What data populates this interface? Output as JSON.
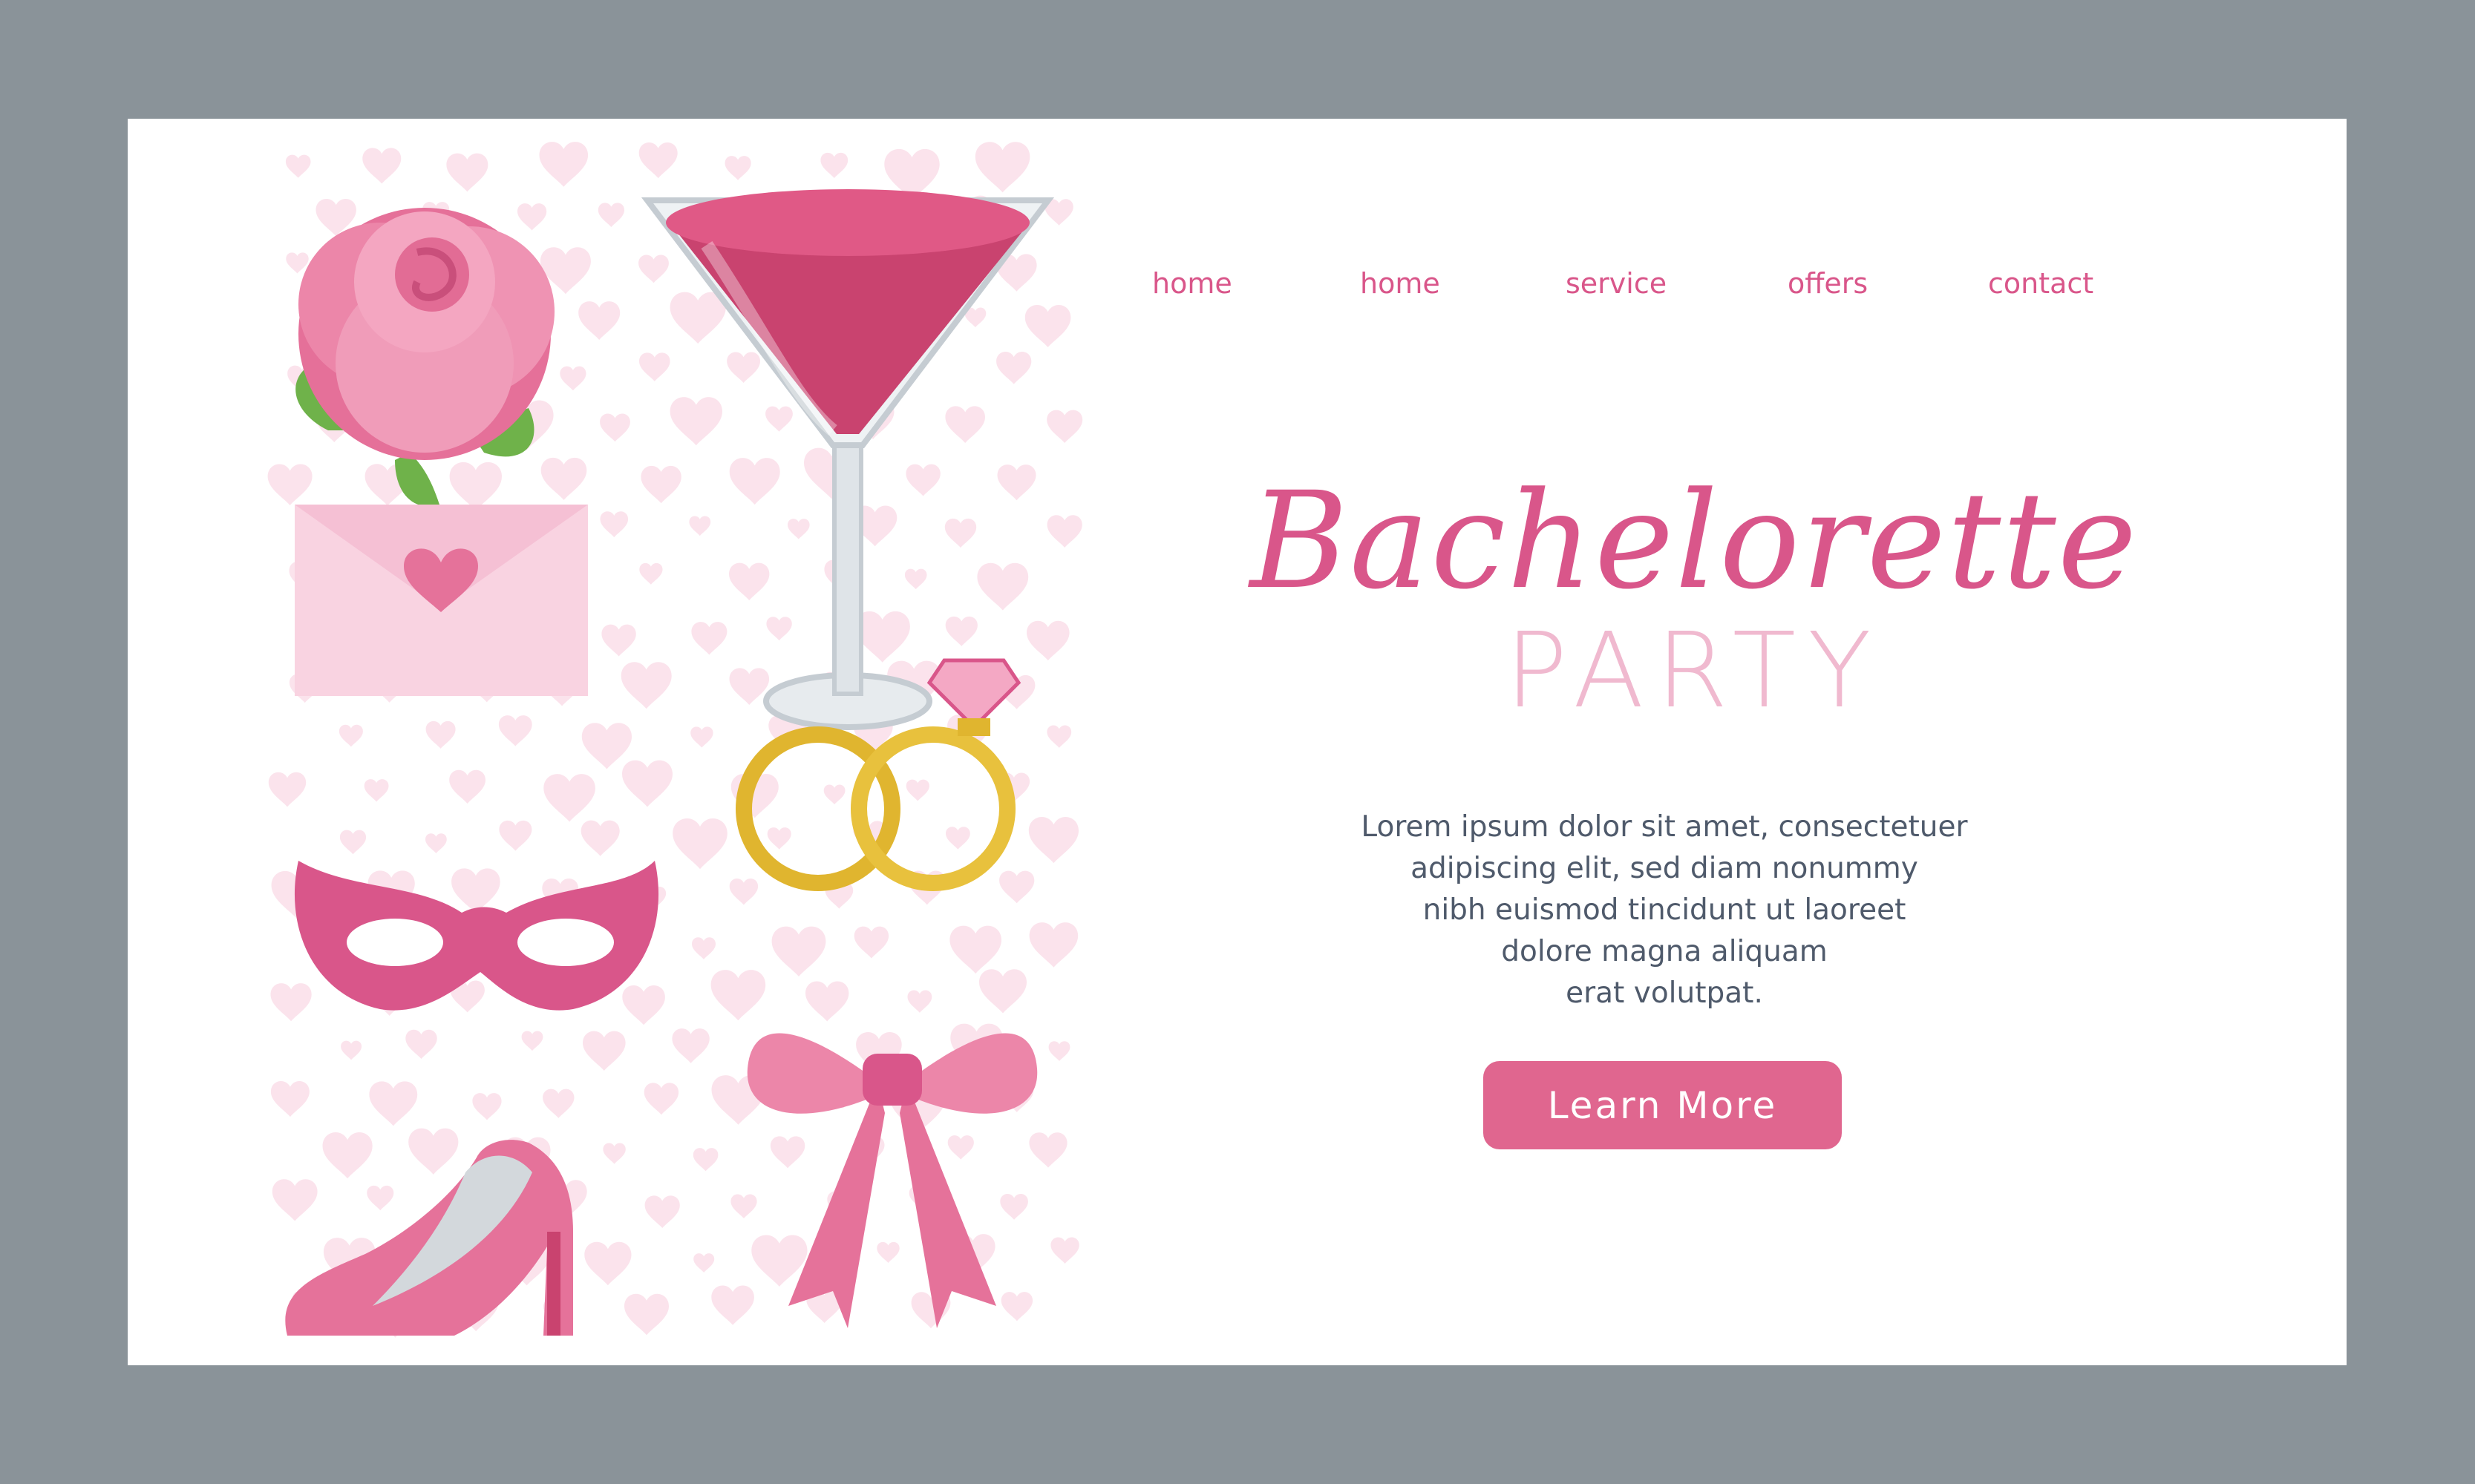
{
  "nav": {
    "items": [
      {
        "label": "home"
      },
      {
        "label": "home"
      },
      {
        "label": "service"
      },
      {
        "label": "offers"
      },
      {
        "label": "contact"
      }
    ]
  },
  "hero": {
    "title_script": "Bachelorette",
    "title_sub": "PARTY",
    "body_lines": [
      "Lorem ipsum dolor sit amet, consectetuer",
      "adipiscing elit, sed diam nonummy",
      "nibh euismod tincidunt ut laoreet",
      "dolore magna aliquam",
      "erat volutpat."
    ],
    "cta_label": "Learn More"
  },
  "illustrations": [
    "rose-icon",
    "cocktail-glass-icon",
    "envelope-icon",
    "wedding-rings-icon",
    "masquerade-mask-icon",
    "high-heel-shoe-icon",
    "bow-icon"
  ],
  "colors": {
    "frame": "#8a9399",
    "page": "#ffffff",
    "accent": "#d9568a",
    "accent_light": "#f0b9cf",
    "button": "#e0668f",
    "heart_bg": "#fbe3ec",
    "text": "#4f5a6b"
  }
}
